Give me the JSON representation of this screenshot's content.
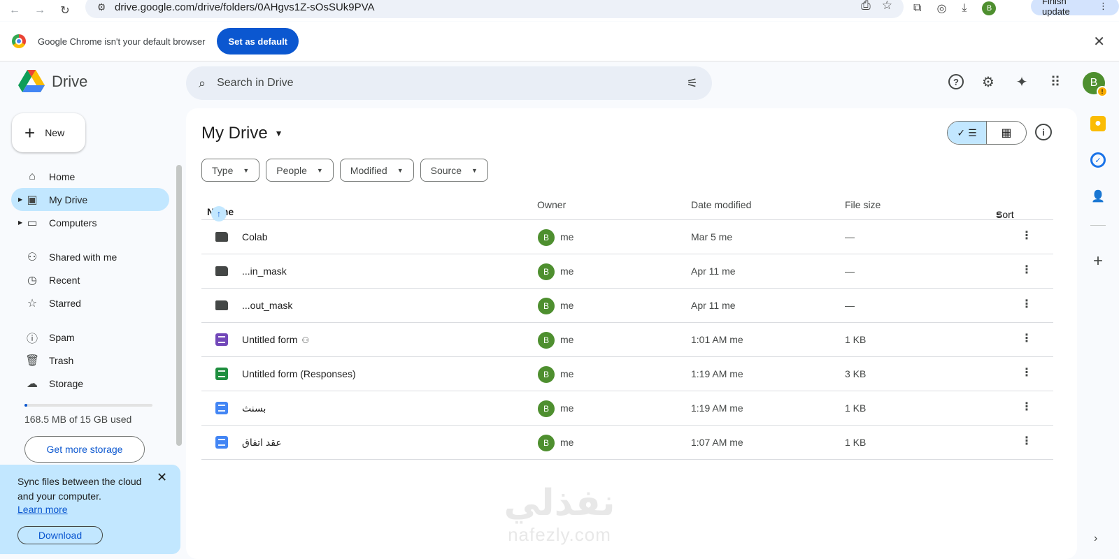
{
  "browser": {
    "url": "drive.google.com/drive/folders/0AHgvs1Z-sOsSUk9PVA",
    "profile_initial": "B",
    "finish_update_label": "Finish update"
  },
  "banner": {
    "message": "Google Chrome isn't your default browser",
    "set_default_label": "Set as default"
  },
  "header": {
    "app_name": "Drive",
    "search_placeholder": "Search in Drive",
    "avatar_initial": "B",
    "avatar_badge": "!"
  },
  "sidebar": {
    "new_label": "New",
    "items": [
      {
        "label": "Home",
        "icon": "home-icon"
      },
      {
        "label": "My Drive",
        "icon": "my-drive-icon"
      },
      {
        "label": "Computers",
        "icon": "computers-icon"
      },
      {
        "label": "Shared with me",
        "icon": "shared-icon"
      },
      {
        "label": "Recent",
        "icon": "clock-icon"
      },
      {
        "label": "Starred",
        "icon": "star-icon"
      },
      {
        "label": "Spam",
        "icon": "spam-icon"
      },
      {
        "label": "Trash",
        "icon": "trash-icon"
      },
      {
        "label": "Storage",
        "icon": "cloud-icon"
      }
    ],
    "storage_used_fraction": 0.011,
    "storage_text": "168.5 MB of 15 GB used",
    "get_storage_label": "Get more storage"
  },
  "sync_card": {
    "text": "Sync files between the cloud and your computer.",
    "learn_more": "Learn more",
    "download_label": "Download"
  },
  "main": {
    "title": "My Drive",
    "filters": [
      "Type",
      "People",
      "Modified",
      "Source"
    ],
    "columns": {
      "name": "Name",
      "owner": "Owner",
      "date": "Date modified",
      "size": "File size",
      "sort": "Sort"
    },
    "files": [
      {
        "name": "Colab",
        "type": "folder",
        "owner": "me",
        "date": "Mar 5 me",
        "size": "—",
        "shared": false
      },
      {
        "name": "...in_mask",
        "type": "folder",
        "owner": "me",
        "date": "Apr 11 me",
        "size": "—",
        "shared": false
      },
      {
        "name": "...out_mask",
        "type": "folder",
        "owner": "me",
        "date": "Apr 11 me",
        "size": "—",
        "shared": false
      },
      {
        "name": "Untitled form",
        "type": "form",
        "owner": "me",
        "date": "1:01 AM me",
        "size": "1 KB",
        "shared": true
      },
      {
        "name": "Untitled form (Responses)",
        "type": "sheet",
        "owner": "me",
        "date": "1:19 AM me",
        "size": "3 KB",
        "shared": false
      },
      {
        "name": "بسنث",
        "type": "doc",
        "owner": "me",
        "date": "1:19 AM me",
        "size": "1 KB",
        "shared": false
      },
      {
        "name": "عقد اتفاق",
        "type": "doc",
        "owner": "me",
        "date": "1:07 AM me",
        "size": "1 KB",
        "shared": false
      }
    ],
    "owner_initial": "B"
  },
  "watermark": {
    "arabic": "نفذلي",
    "latin": "nafezly.com"
  }
}
